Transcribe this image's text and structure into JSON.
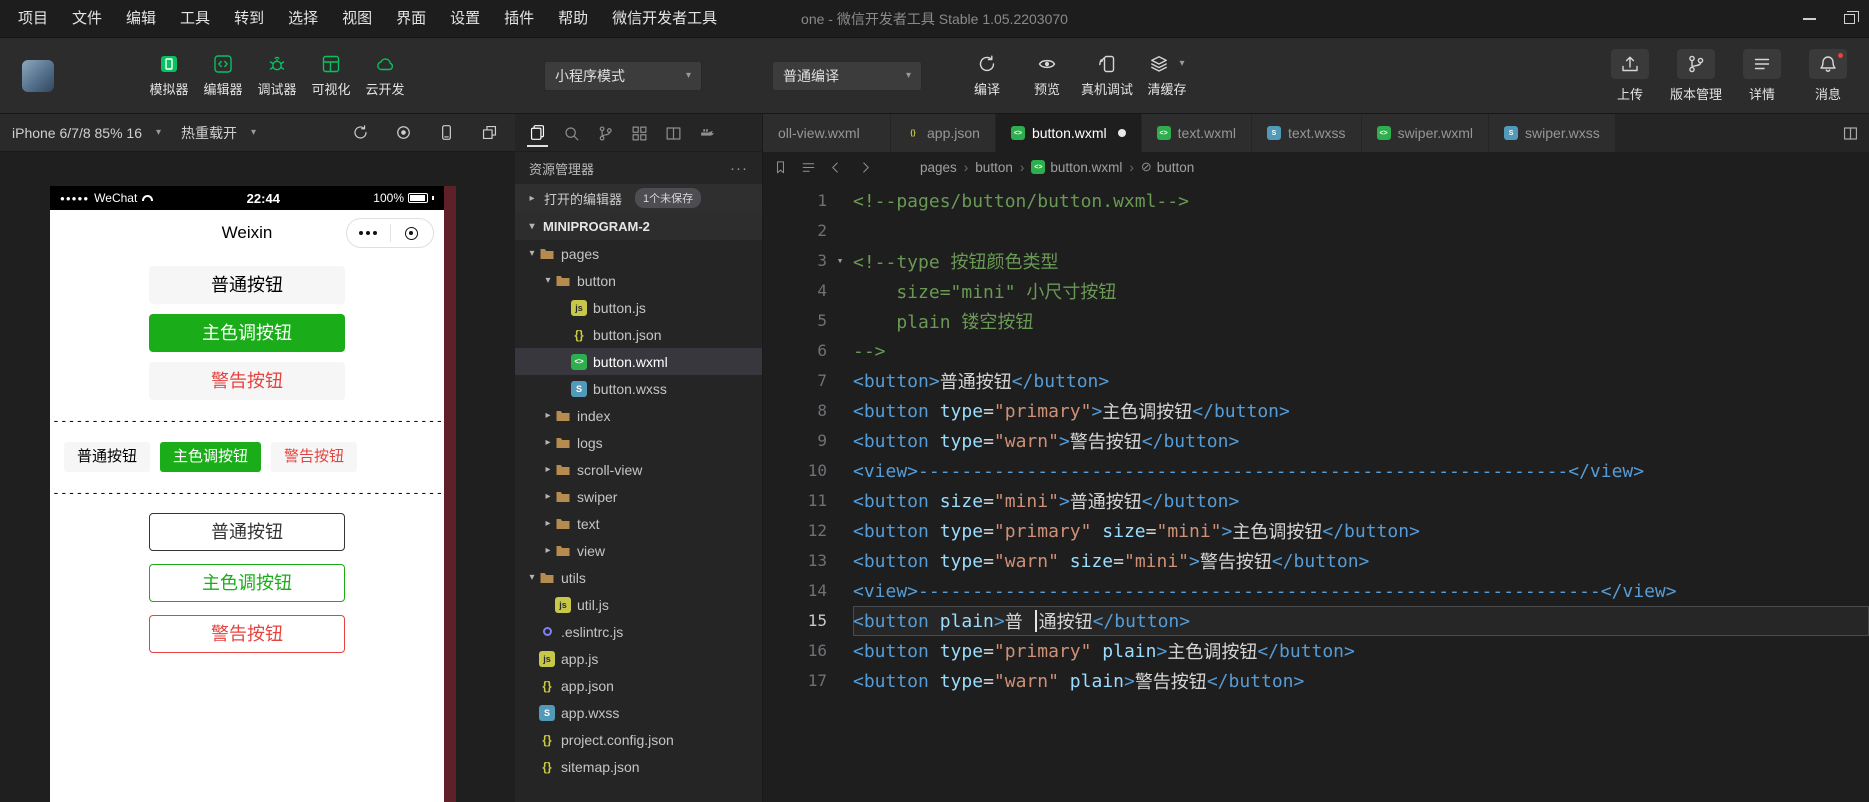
{
  "colors": {
    "accent": "#07c160",
    "primary_button": "#1aad19",
    "warn": "#e64340",
    "editor_bg": "#1e1e1e"
  },
  "menubar": {
    "items": [
      "项目",
      "文件",
      "编辑",
      "工具",
      "转到",
      "选择",
      "视图",
      "界面",
      "设置",
      "插件",
      "帮助",
      "微信开发者工具"
    ],
    "title": "one  -  微信开发者工具 Stable 1.05.2203070"
  },
  "toolbar": {
    "left_buttons": [
      {
        "label": "模拟器",
        "icon": "simulator"
      },
      {
        "label": "编辑器",
        "icon": "editor"
      },
      {
        "label": "调试器",
        "icon": "debugger"
      },
      {
        "label": "可视化",
        "icon": "visualizer"
      },
      {
        "label": "云开发",
        "icon": "cloud"
      }
    ],
    "mode_select": "小程序模式",
    "compile_select": "普通编译",
    "compile_buttons": [
      {
        "label": "编译",
        "icon": "compile",
        "dropdown": false
      },
      {
        "label": "预览",
        "icon": "preview",
        "dropdown": false
      },
      {
        "label": "真机调试",
        "icon": "remote",
        "dropdown": false
      },
      {
        "label": "清缓存",
        "icon": "clear",
        "dropdown": true
      }
    ],
    "right_buttons": [
      {
        "label": "上传",
        "icon": "upload",
        "dot": false
      },
      {
        "label": "版本管理",
        "icon": "version",
        "dot": false
      },
      {
        "label": "详情",
        "icon": "details",
        "dot": false
      },
      {
        "label": "消息",
        "icon": "message",
        "dot": true
      }
    ]
  },
  "simulator": {
    "device": "iPhone 6/7/8 85% 16",
    "hot_reload": "热重载开",
    "phone": {
      "status": {
        "signal": "●●●●●",
        "carrier": "WeChat",
        "time": "22:44",
        "battery": "100%"
      },
      "nav_title": "Weixin",
      "buttons_normal": [
        {
          "label": "普通按钮",
          "type": "default"
        },
        {
          "label": "主色调按钮",
          "type": "primary"
        },
        {
          "label": "警告按钮",
          "type": "warn"
        }
      ],
      "buttons_mini": [
        {
          "label": "普通按钮",
          "type": "default"
        },
        {
          "label": "主色调按钮",
          "type": "primary"
        },
        {
          "label": "警告按钮",
          "type": "warn"
        }
      ],
      "buttons_plain": [
        {
          "label": "普通按钮",
          "type": "default"
        },
        {
          "label": "主色调按钮",
          "type": "primary"
        },
        {
          "label": "警告按钮",
          "type": "warn"
        }
      ],
      "divider": "----------------------------------------------------------------------"
    }
  },
  "explorer": {
    "title": "资源管理器",
    "more": "···",
    "open_editors": "打开的编辑器",
    "unsaved_badge": "1个未保存",
    "project": "MINIPROGRAM-2",
    "tree": [
      {
        "label": "pages",
        "type": "folder",
        "depth": 0,
        "expanded": true
      },
      {
        "label": "button",
        "type": "folder",
        "depth": 1,
        "expanded": true
      },
      {
        "label": "button.js",
        "type": "js",
        "depth": 2
      },
      {
        "label": "button.json",
        "type": "json",
        "depth": 2
      },
      {
        "label": "button.wxml",
        "type": "wxml",
        "depth": 2,
        "selected": true
      },
      {
        "label": "button.wxss",
        "type": "wxss",
        "depth": 2
      },
      {
        "label": "index",
        "type": "folder",
        "depth": 1,
        "expanded": false
      },
      {
        "label": "logs",
        "type": "folder",
        "depth": 1,
        "expanded": false
      },
      {
        "label": "scroll-view",
        "type": "folder",
        "depth": 1,
        "expanded": false
      },
      {
        "label": "swiper",
        "type": "folder",
        "depth": 1,
        "expanded": false
      },
      {
        "label": "text",
        "type": "folder",
        "depth": 1,
        "expanded": false
      },
      {
        "label": "view",
        "type": "folder",
        "depth": 1,
        "expanded": false
      },
      {
        "label": "utils",
        "type": "folder",
        "depth": 0,
        "expanded": true
      },
      {
        "label": "util.js",
        "type": "js",
        "depth": 1
      },
      {
        "label": ".eslintrc.js",
        "type": "eslint",
        "depth": 0
      },
      {
        "label": "app.js",
        "type": "js",
        "depth": 0
      },
      {
        "label": "app.json",
        "type": "json",
        "depth": 0
      },
      {
        "label": "app.wxss",
        "type": "wxss",
        "depth": 0
      },
      {
        "label": "project.config.json",
        "type": "json",
        "depth": 0
      },
      {
        "label": "sitemap.json",
        "type": "json",
        "depth": 0
      }
    ]
  },
  "editor": {
    "tabs": [
      {
        "label": "oll-view.wxml",
        "icon": null,
        "active": false,
        "dirty": false,
        "cut": true
      },
      {
        "label": "app.json",
        "icon": "json",
        "active": false,
        "dirty": false,
        "cut": false
      },
      {
        "label": "button.wxml",
        "icon": "wxml",
        "active": true,
        "dirty": true,
        "cut": false
      },
      {
        "label": "text.wxml",
        "icon": "wxml",
        "active": false,
        "dirty": false,
        "cut": false
      },
      {
        "label": "text.wxss",
        "icon": "wxss",
        "active": false,
        "dirty": false,
        "cut": false
      },
      {
        "label": "swiper.wxml",
        "icon": "wxml",
        "active": false,
        "dirty": false,
        "cut": false
      },
      {
        "label": "swiper.wxss",
        "icon": "wxss",
        "active": false,
        "dirty": false,
        "cut": false
      }
    ],
    "breadcrumb": [
      {
        "label": "pages",
        "icon": null
      },
      {
        "label": "button",
        "icon": null
      },
      {
        "label": "button.wxml",
        "icon": "wxml"
      },
      {
        "label": "button",
        "icon": "symbol"
      }
    ],
    "code": [
      {
        "tokens": [
          [
            "c",
            "<!--pages/button/button.wxml-->"
          ]
        ]
      },
      {
        "tokens": []
      },
      {
        "fold": true,
        "tokens": [
          [
            "c",
            "<!--type 按钮颜色类型"
          ]
        ]
      },
      {
        "tokens": [
          [
            "c",
            "    size=\"mini\" 小尺寸按钮"
          ]
        ]
      },
      {
        "tokens": [
          [
            "c",
            "    plain 镂空按钮"
          ]
        ]
      },
      {
        "tokens": [
          [
            "c",
            "-->"
          ]
        ]
      },
      {
        "tokens": [
          [
            "g",
            "<button>"
          ],
          [
            "x",
            "普通按钮"
          ],
          [
            "g",
            "</button>"
          ]
        ]
      },
      {
        "tokens": [
          [
            "g",
            "<button"
          ],
          [
            "x",
            " "
          ],
          [
            "a",
            "type"
          ],
          [
            "x",
            "="
          ],
          [
            "s",
            "\"primary\""
          ],
          [
            "g",
            ">"
          ],
          [
            "x",
            "主色调按钮"
          ],
          [
            "g",
            "</button>"
          ]
        ]
      },
      {
        "tokens": [
          [
            "g",
            "<button"
          ],
          [
            "x",
            " "
          ],
          [
            "a",
            "type"
          ],
          [
            "x",
            "="
          ],
          [
            "s",
            "\"warn\""
          ],
          [
            "g",
            ">"
          ],
          [
            "x",
            "警告按钮"
          ],
          [
            "g",
            "</button>"
          ]
        ]
      },
      {
        "tokens": [
          [
            "g",
            "<view>------------------------------------------------------------</view>"
          ]
        ]
      },
      {
        "tokens": [
          [
            "g",
            "<button"
          ],
          [
            "x",
            " "
          ],
          [
            "a",
            "size"
          ],
          [
            "x",
            "="
          ],
          [
            "s",
            "\"mini\""
          ],
          [
            "g",
            ">"
          ],
          [
            "x",
            "普通按钮"
          ],
          [
            "g",
            "</button>"
          ]
        ]
      },
      {
        "tokens": [
          [
            "g",
            "<button"
          ],
          [
            "x",
            " "
          ],
          [
            "a",
            "type"
          ],
          [
            "x",
            "="
          ],
          [
            "s",
            "\"primary\""
          ],
          [
            "x",
            " "
          ],
          [
            "a",
            "size"
          ],
          [
            "x",
            "="
          ],
          [
            "s",
            "\"mini\""
          ],
          [
            "g",
            ">"
          ],
          [
            "x",
            "主色调按钮"
          ],
          [
            "g",
            "</button>"
          ]
        ]
      },
      {
        "tokens": [
          [
            "g",
            "<button"
          ],
          [
            "x",
            " "
          ],
          [
            "a",
            "type"
          ],
          [
            "x",
            "="
          ],
          [
            "s",
            "\"warn\""
          ],
          [
            "x",
            " "
          ],
          [
            "a",
            "size"
          ],
          [
            "x",
            "="
          ],
          [
            "s",
            "\"mini\""
          ],
          [
            "g",
            ">"
          ],
          [
            "x",
            "警告按钮"
          ],
          [
            "g",
            "</button>"
          ]
        ]
      },
      {
        "tokens": [
          [
            "g",
            "<view>---------------------------------------------------------------</view>"
          ]
        ]
      },
      {
        "current": true,
        "tokens": [
          [
            "g",
            "<button"
          ],
          [
            "x",
            " "
          ],
          [
            "a",
            "plain"
          ],
          [
            "g",
            ">"
          ],
          [
            "x",
            "普 "
          ],
          [
            "cur",
            ""
          ],
          [
            "x",
            "通按钮"
          ],
          [
            "g",
            "</button>"
          ]
        ]
      },
      {
        "tokens": [
          [
            "g",
            "<button"
          ],
          [
            "x",
            " "
          ],
          [
            "a",
            "type"
          ],
          [
            "x",
            "="
          ],
          [
            "s",
            "\"primary\""
          ],
          [
            "x",
            " "
          ],
          [
            "a",
            "plain"
          ],
          [
            "g",
            ">"
          ],
          [
            "x",
            "主色调按钮"
          ],
          [
            "g",
            "</button>"
          ]
        ]
      },
      {
        "tokens": [
          [
            "g",
            "<button"
          ],
          [
            "x",
            " "
          ],
          [
            "a",
            "type"
          ],
          [
            "x",
            "="
          ],
          [
            "s",
            "\"warn\""
          ],
          [
            "x",
            " "
          ],
          [
            "a",
            "plain"
          ],
          [
            "g",
            ">"
          ],
          [
            "x",
            "警告按钮"
          ],
          [
            "g",
            "</button>"
          ]
        ]
      }
    ]
  }
}
